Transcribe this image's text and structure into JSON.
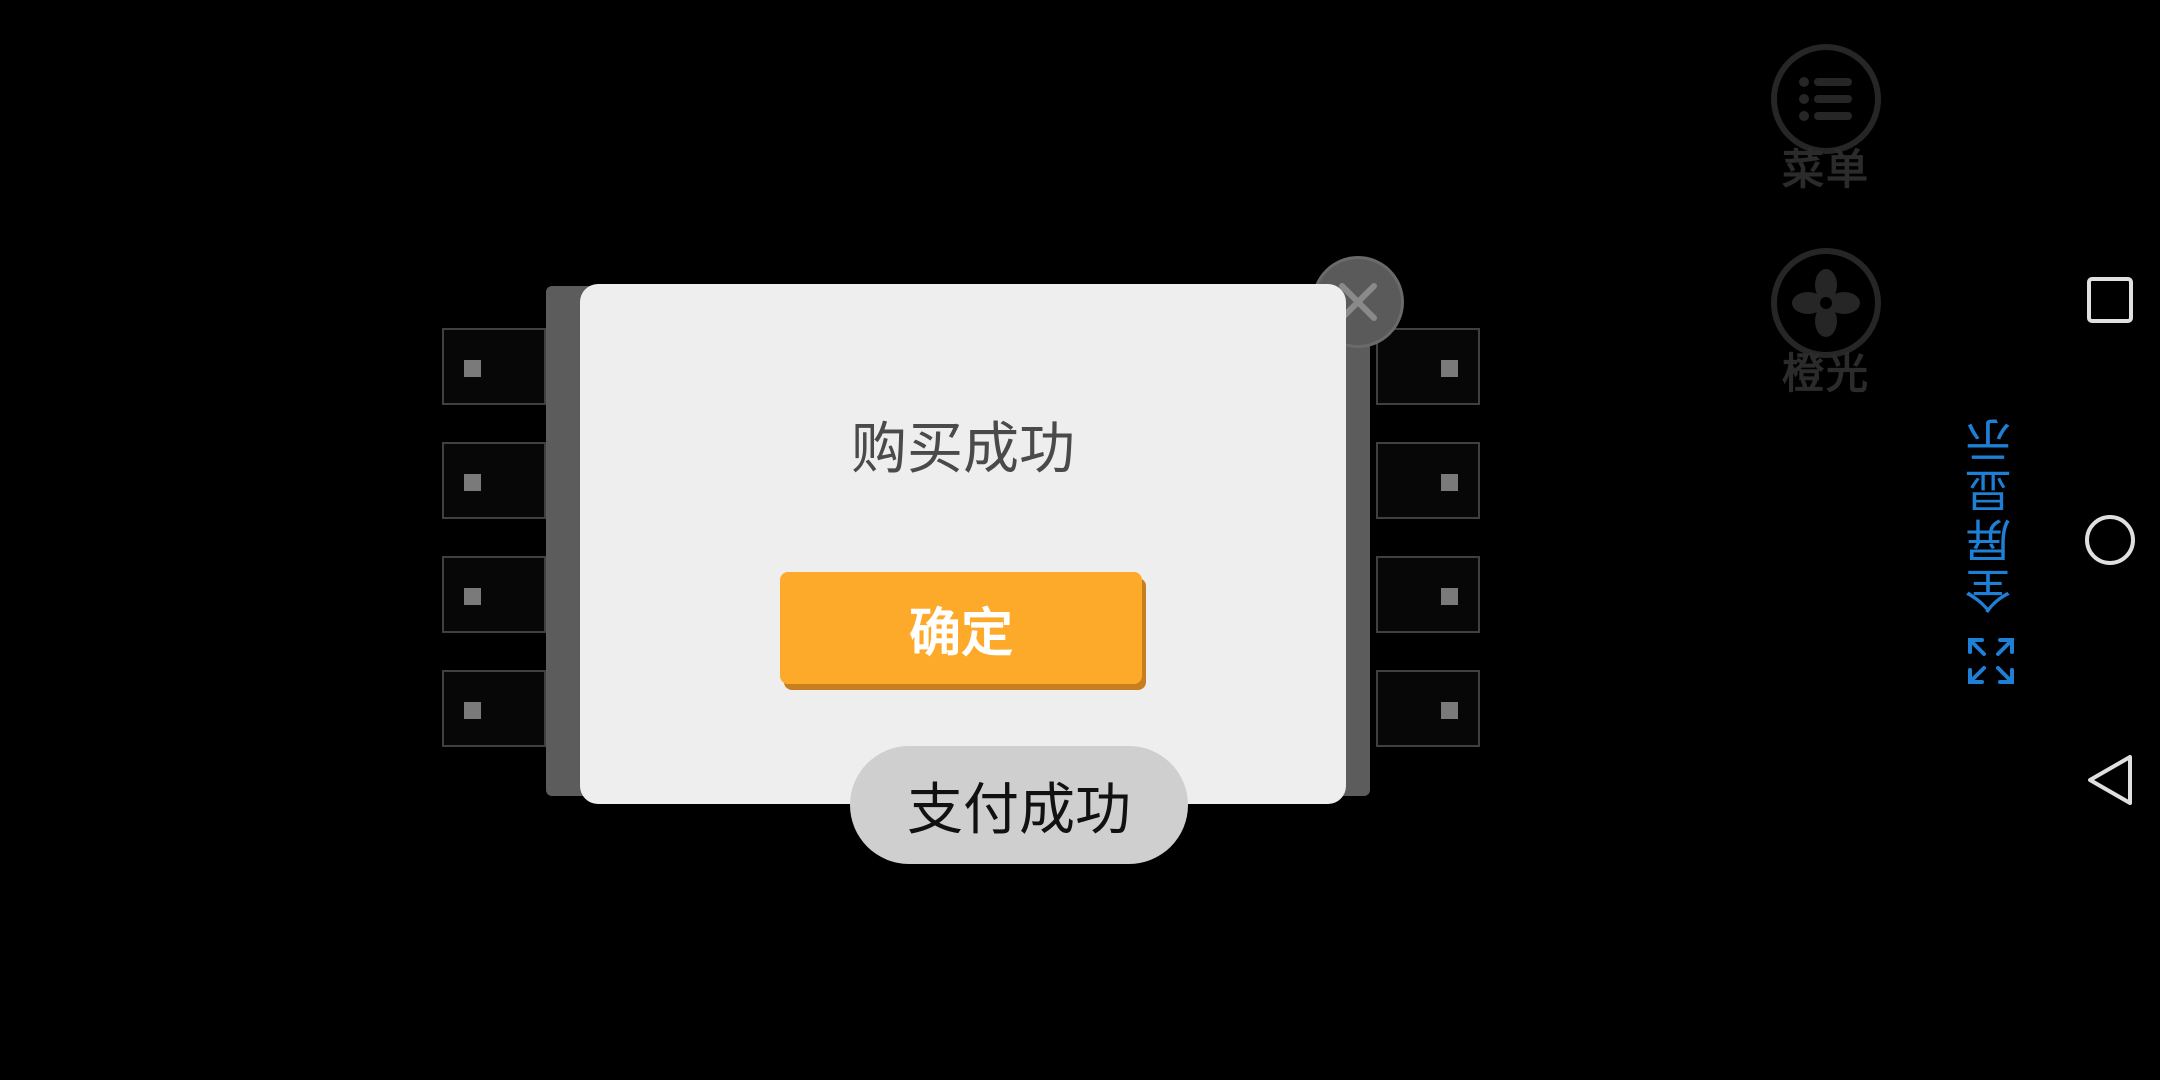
{
  "dialog": {
    "title": "购买成功",
    "confirm_label": "确定"
  },
  "toast": {
    "text": "支付成功"
  },
  "float_menu": {
    "menu_label": "菜单",
    "light_label": "橙光"
  },
  "fullscreen": {
    "label": "全屏显示"
  },
  "icons": {
    "close": "close-icon",
    "menu": "list-icon",
    "light": "fan-icon",
    "fullscreen": "expand-icon",
    "recents": "square-icon",
    "home": "circle-icon",
    "back": "triangle-back-icon"
  },
  "colors": {
    "accent": "#fdaa2b",
    "link": "#1e7fd6",
    "dialog_bg": "#eeeeee",
    "toast_bg": "#cfcfcf"
  }
}
